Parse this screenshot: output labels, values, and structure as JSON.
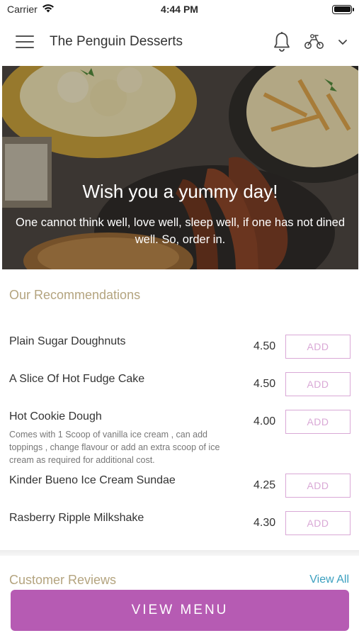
{
  "status_bar": {
    "carrier": "Carrier",
    "time": "4:44 PM"
  },
  "header": {
    "title": "The Penguin Desserts",
    "icons": [
      "hamburger-menu-icon",
      "bell-icon",
      "scooter-icon",
      "chevron-down-icon"
    ]
  },
  "hero": {
    "title": "Wish you a yummy day!",
    "subtitle": "One cannot think well, love well, sleep well, if one has not dined well. So, order in."
  },
  "recommendations": {
    "title": "Our Recommendations",
    "items": [
      {
        "name": "Plain Sugar Doughnuts",
        "description": "",
        "price": "4.50",
        "button": "ADD"
      },
      {
        "name": "A Slice Of Hot Fudge Cake",
        "description": "",
        "price": "4.50",
        "button": "ADD"
      },
      {
        "name": "Hot Cookie Dough",
        "description": "Comes with 1 Scoop of vanilla ice cream , can add toppings , change flavour or add an extra scoop of ice cream as required for additional cost.",
        "price": "4.00",
        "button": "ADD"
      },
      {
        "name": "Kinder Bueno Ice Cream Sundae",
        "description": "",
        "price": "4.25",
        "button": "ADD"
      },
      {
        "name": "Rasberry Ripple Milkshake",
        "description": "",
        "price": "4.30",
        "button": "ADD"
      }
    ]
  },
  "reviews": {
    "title": "Customer Reviews",
    "view_all": "View All"
  },
  "footer": {
    "button": "VIEW MENU"
  },
  "colors": {
    "accent": "#b65bb3",
    "section_title": "#b4a47f",
    "add_border": "#d9a8d6",
    "link": "#3a9fbf"
  }
}
